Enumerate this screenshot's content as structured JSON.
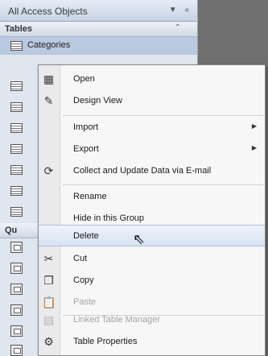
{
  "nav_pane": {
    "title": "All Access Objects",
    "header_icons": [
      "dropdown-icon",
      "collapse-icon"
    ],
    "tables_group": {
      "label": "Tables",
      "chevron": "collapse-chevron"
    },
    "selected_item": "Categories",
    "queries_group": {
      "label": "Qu"
    }
  },
  "context_menu": {
    "items": [
      {
        "label": "Open",
        "icon": "open-icon",
        "enabled": true
      },
      {
        "label": "Design View",
        "icon": "design-view-icon",
        "enabled": true
      },
      {
        "label": "Import",
        "icon": "",
        "enabled": true,
        "submenu": true
      },
      {
        "label": "Export",
        "icon": "",
        "enabled": true,
        "submenu": true
      },
      {
        "label": "Collect and Update Data via E-mail",
        "icon": "collect-email-icon",
        "enabled": true
      },
      {
        "label": "Rename",
        "icon": "",
        "enabled": true
      },
      {
        "label": "Hide in this Group",
        "icon": "",
        "enabled": true
      },
      {
        "label": "Delete",
        "icon": "",
        "enabled": true,
        "highlighted": true
      },
      {
        "label": "Cut",
        "icon": "cut-icon",
        "enabled": true
      },
      {
        "label": "Copy",
        "icon": "copy-icon",
        "enabled": true
      },
      {
        "label": "Paste",
        "icon": "paste-icon",
        "enabled": false
      },
      {
        "label": "Linked Table Manager",
        "icon": "linked-table-icon",
        "enabled": false
      },
      {
        "label": "Table Properties",
        "icon": "table-properties-icon",
        "enabled": true
      }
    ]
  }
}
